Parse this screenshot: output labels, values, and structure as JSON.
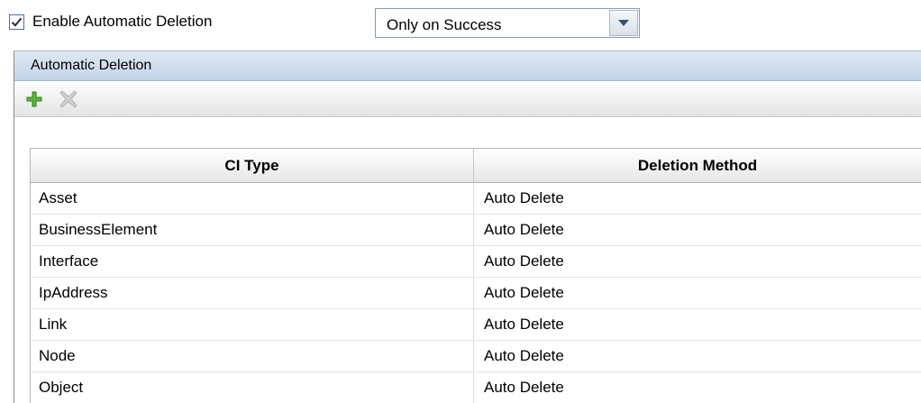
{
  "options": {
    "enable_auto_deletion": {
      "label": "Enable Automatic Deletion",
      "checked": true
    },
    "deletion_condition": {
      "selected": "Only on Success"
    }
  },
  "panel": {
    "title": "Automatic Deletion",
    "toolbar": {
      "add_icon": "add-icon",
      "delete_icon": "delete-icon"
    }
  },
  "table": {
    "columns": [
      "CI Type",
      "Deletion Method"
    ],
    "rows": [
      [
        "Asset",
        "Auto Delete"
      ],
      [
        "BusinessElement",
        "Auto Delete"
      ],
      [
        "Interface",
        "Auto Delete"
      ],
      [
        "IpAddress",
        "Auto Delete"
      ],
      [
        "Link",
        "Auto Delete"
      ],
      [
        "Node",
        "Auto Delete"
      ],
      [
        "Object",
        "Auto Delete"
      ]
    ]
  },
  "colors": {
    "accent_green": "#3f9d22",
    "disabled_gray": "#c4c4c4",
    "header_blue": "#c3d4e8"
  }
}
